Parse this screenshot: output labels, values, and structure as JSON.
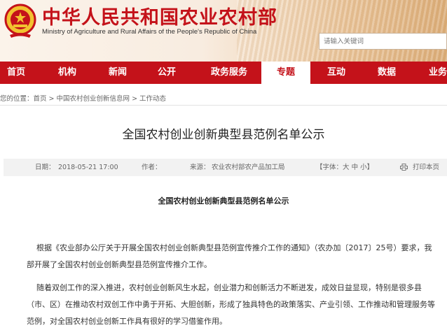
{
  "header": {
    "title": "中华人民共和国农业农村部",
    "subtitle": "Ministry of Agriculture and Rural Affairs of the People's Republic of China",
    "search_placeholder": "请输入关键词"
  },
  "nav": {
    "items": [
      {
        "label": "首页"
      },
      {
        "label": "机构"
      },
      {
        "label": "新闻"
      },
      {
        "label": "公开"
      },
      {
        "label": "政务服务"
      },
      {
        "label": "专题",
        "active": true
      },
      {
        "label": "互动"
      },
      {
        "label": "数据"
      },
      {
        "label": "业务"
      }
    ]
  },
  "breadcrumb": {
    "prefix": "您的位置：",
    "items": [
      "首页",
      "中国农村创业创新信息网",
      "工作动态"
    ],
    "separator": " > "
  },
  "article": {
    "title": "全国农村创业创新典型县范例名单公示",
    "meta": {
      "date_label": "日期：",
      "date": "2018-05-21 17:00",
      "author_label": "作者：",
      "author": "",
      "source_label": "来源：",
      "source": "农业农村部农产品加工局",
      "font_label": "【字体：",
      "font_sizes": [
        "大",
        "中",
        "小"
      ],
      "font_close": "】",
      "print_label": "打印本页"
    },
    "subtitle": "全国农村创业创新典型县范例名单公示",
    "paragraphs": [
      [
        "根据《农业部办公厅关于开展全国农村创业创新典型县范例宣传推介工作的通知》（农办加〔2017〕25号）要求，我",
        "部开展了全国农村创业创新典型县范例宣传推介工作。"
      ],
      [
        "随着双创工作的深入推进，农村创业创新风生水起，创业潜力和创新活力不断迸发，成效日益显现，特别是很多县",
        "（市、区）在推动农村双创工作中勇于开拓、大胆创新，形成了独具特色的政策落实、产业引领、工作推动和管理服务等",
        "范例，对全国农村创业创新工作具有很好的学习借鉴作用。"
      ]
    ]
  },
  "colors": {
    "brand_red": "#c4121a",
    "meta_bg": "#f2f2f2"
  },
  "icons": {
    "emblem": "national-emblem-icon",
    "print": "printer-icon"
  }
}
